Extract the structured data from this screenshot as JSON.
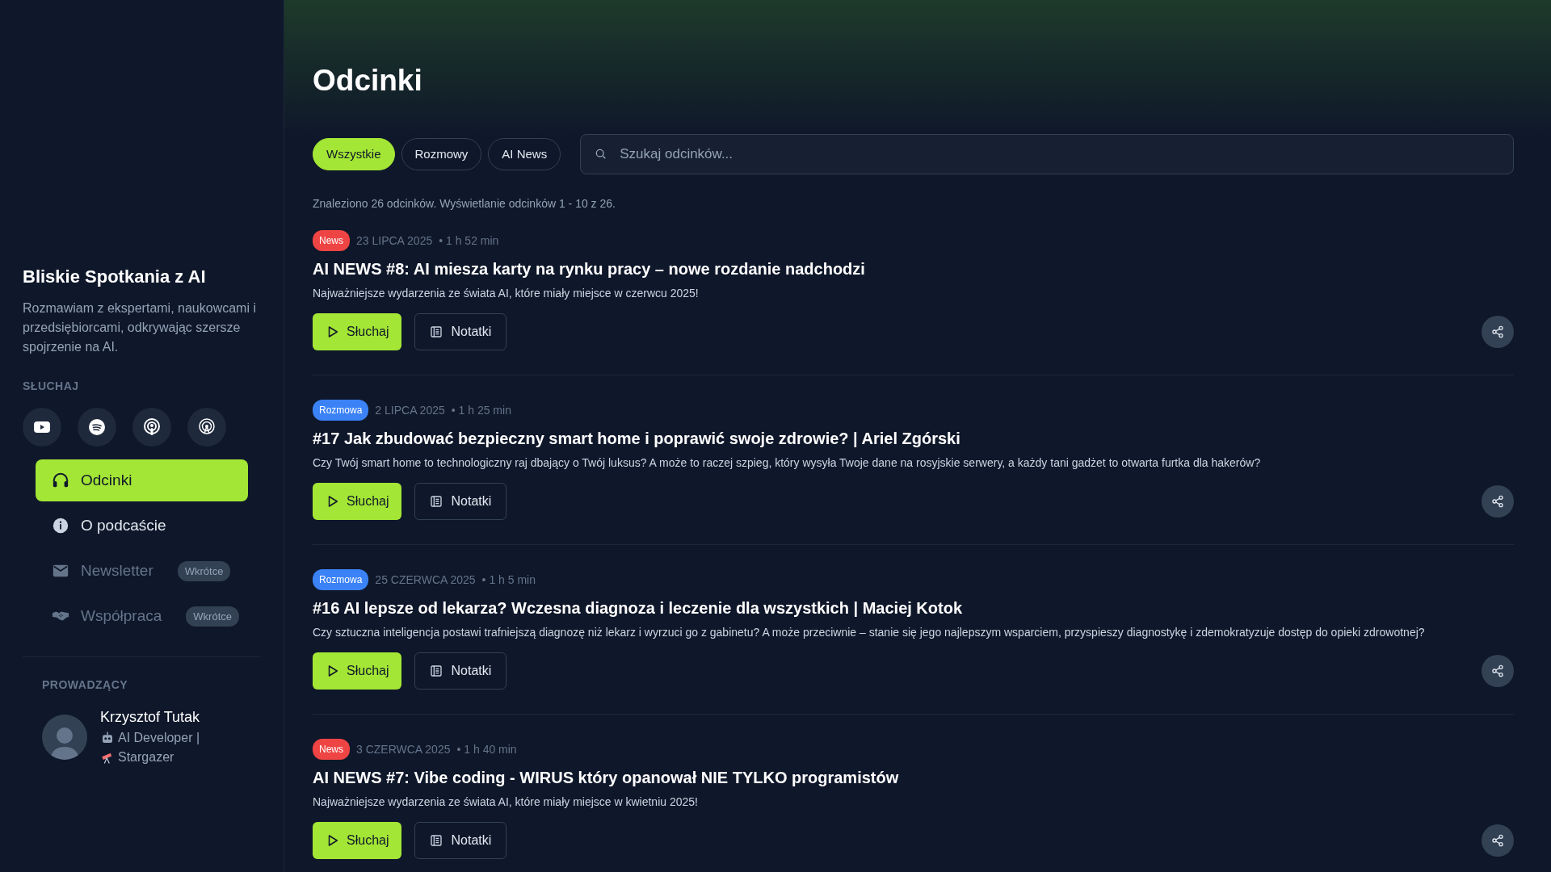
{
  "sidebar": {
    "title": "Bliskie Spotkania z AI",
    "description": "Rozmawiam z ekspertami, naukowcami i przedsiębiorcami, odkrywając szersze spojrzenie na AI.",
    "listen_label": "SŁUCHAJ",
    "nav": [
      {
        "label": "Odcinki",
        "selected": true,
        "disabled": false
      },
      {
        "label": "O podcaście",
        "selected": false,
        "disabled": false
      },
      {
        "label": "Newsletter",
        "selected": false,
        "disabled": true,
        "badge": "Wkrótce"
      },
      {
        "label": "Współpraca",
        "selected": false,
        "disabled": true,
        "badge": "Wkrótce"
      }
    ],
    "host": {
      "section_label": "PROWADZĄCY",
      "name": "Krzysztof Tutak",
      "bio": [
        "AI Developer |",
        "Stargazer"
      ]
    }
  },
  "main": {
    "title": "Odcinki",
    "filters": [
      {
        "label": "Wszystkie",
        "selected": true
      },
      {
        "label": "Rozmowy",
        "selected": false
      },
      {
        "label": "AI News",
        "selected": false
      }
    ],
    "search": {
      "placeholder": "Szukaj odcinków..."
    },
    "summary": "Znaleziono 26 odcinków. Wyświetlanie odcinków 1 - 10 z 26.",
    "episodes": [
      {
        "kind": "news",
        "badge": "News",
        "date": "23 LIPCA 2025",
        "duration": "• 1 h 52 min",
        "title": "AI NEWS #8: AI miesza karty na rynku pracy – nowe rozdanie nadchodzi",
        "description": "Najważniejsze wydarzenia ze świata AI, które miały miejsce w czerwcu 2025!",
        "listen": "Słuchaj",
        "notes": "Notatki"
      },
      {
        "kind": "interview",
        "badge": "Rozmowa",
        "date": "2 LIPCA 2025",
        "duration": "• 1 h 25 min",
        "title": "#17 Jak zbudować bezpieczny smart home i poprawić swoje zdrowie? | Ariel Zgórski",
        "description": "Czy Twój smart home to technologiczny raj dbający o Twój luksus? A może to raczej szpieg, który wysyła Twoje dane na rosyjskie serwery, a każdy tani gadżet to otwarta furtka dla hakerów?",
        "listen": "Słuchaj",
        "notes": "Notatki"
      },
      {
        "kind": "interview",
        "badge": "Rozmowa",
        "date": "25 CZERWCA 2025",
        "duration": "• 1 h 5 min",
        "title": "#16 AI lepsze od lekarza? Wczesna diagnoza i leczenie dla wszystkich | Maciej Kotok",
        "description": "Czy sztuczna inteligencja postawi trafniejszą diagnozę niż lekarz i wyrzuci go z gabinetu? A może przeciwnie – stanie się jego najlepszym wsparciem, przyspieszy diagnostykę i zdemokratyzuje dostęp do opieki zdrowotnej?",
        "listen": "Słuchaj",
        "notes": "Notatki"
      },
      {
        "kind": "news",
        "badge": "News",
        "date": "3 CZERWCA 2025",
        "duration": "• 1 h 40 min",
        "title": "AI NEWS #7: Vibe coding - WIRUS który opanował NIE TYLKO programistów",
        "description": "Najważniejsze wydarzenia ze świata AI, które miały miejsce w kwietniu 2025!",
        "listen": "Słuchaj",
        "notes": "Notatki"
      }
    ]
  }
}
